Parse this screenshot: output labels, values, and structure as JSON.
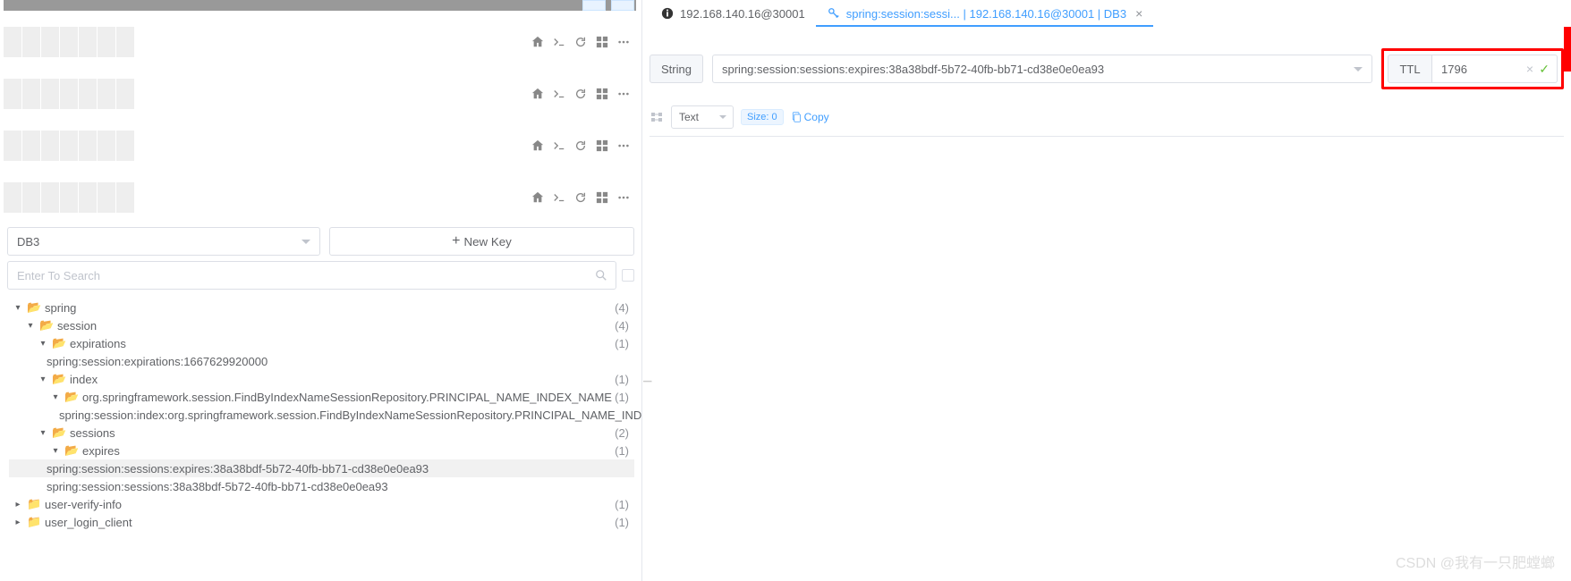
{
  "dbSelector": {
    "value": "DB3"
  },
  "newKeyBtn": "New Key",
  "searchPlaceholder": "Enter To Search",
  "tree": {
    "spring": {
      "label": "spring",
      "count": "(4)"
    },
    "session": {
      "label": "session",
      "count": "(4)"
    },
    "expirations": {
      "label": "expirations",
      "count": "(1)"
    },
    "expirationsKey": "spring:session:expirations:1667629920000",
    "index": {
      "label": "index",
      "count": "(1)"
    },
    "indexFolder": {
      "label": "org.springframework.session.FindByIndexNameSessionRepository.PRINCIPAL_NAME_INDEX_NAME",
      "count": "(1)"
    },
    "indexKey": "spring:session:index:org.springframework.session.FindByIndexNameSessionRepository.PRINCIPAL_NAME_INDEX_NAME:...",
    "sessions": {
      "label": "sessions",
      "count": "(2)"
    },
    "expires": {
      "label": "expires",
      "count": "(1)"
    },
    "expiresKey": "spring:session:sessions:expires:38a38bdf-5b72-40fb-bb71-cd38e0e0ea93",
    "sessionsKey": "spring:session:sessions:38a38bdf-5b72-40fb-bb71-cd38e0e0ea93",
    "uvi": {
      "label": "user-verify-info",
      "count": "(1)"
    },
    "ulc": {
      "label": "user_login_client",
      "count": "(1)"
    }
  },
  "tabs": {
    "tab1": {
      "label": "192.168.140.16@30001"
    },
    "tab2": {
      "label": "spring:session:sessi... | 192.168.140.16@30001 | DB3"
    }
  },
  "keyBar": {
    "type": "String",
    "key": "spring:session:sessions:expires:38a38bdf-5b72-40fb-bb71-cd38e0e0ea93",
    "ttlLabel": "TTL",
    "ttl": "1796"
  },
  "valueBar": {
    "viewMode": "Text",
    "size": "Size: 0",
    "copy": "Copy"
  },
  "watermark": "CSDN @我有一只肥螳螂"
}
